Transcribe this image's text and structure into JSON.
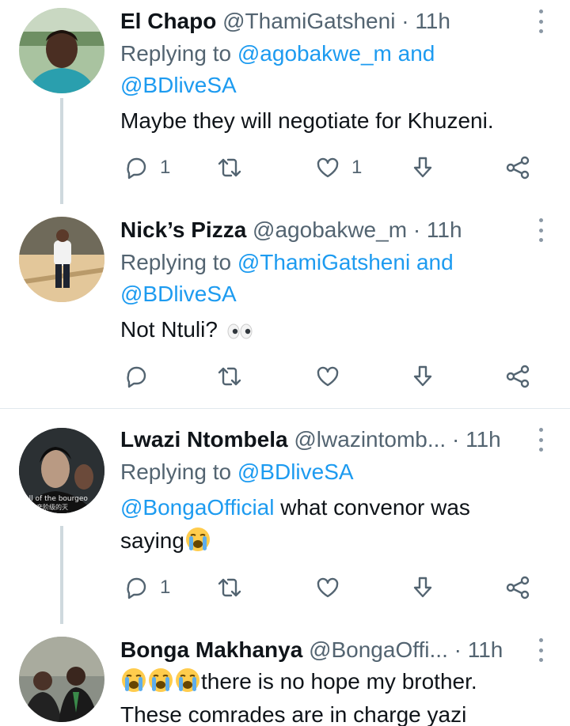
{
  "tweets": [
    {
      "name": "El Chapo",
      "handle": "@ThamiGatsheni",
      "time": "11h",
      "replying_prefix": "Replying to",
      "replying_users_line1": "@agobakwe_m and",
      "replying_users_line2": "@BDliveSA",
      "text": "Maybe they will negotiate for Khuzeni.",
      "reply_count": "1",
      "retweet_count": "",
      "like_count": "1"
    },
    {
      "name": "Nick’s Pizza",
      "handle": "@agobakwe_m",
      "time": "11h",
      "replying_prefix": "Replying to",
      "replying_users_line1": "@ThamiGatsheni and",
      "replying_users_line2": "@BDliveSA",
      "text": "Not Ntuli?",
      "emoji": "eyes",
      "reply_count": "",
      "retweet_count": "",
      "like_count": ""
    },
    {
      "name": "Lwazi Ntombela",
      "handle": "@lwazintomb...",
      "time": "11h",
      "replying_prefix": "Replying to",
      "replying_users_line1": "@BDliveSA",
      "mention": "@BongaOfficial",
      "text_line1": " what convenor was",
      "text_line2": "saying",
      "emoji": "loudly-crying-face",
      "avatar_caption": "fall of the bourgeo",
      "avatar_caption_sub": "资产阶级的灭",
      "reply_count": "1",
      "retweet_count": "",
      "like_count": ""
    },
    {
      "name": "Bonga Makhanya",
      "handle": "@BongaOffi...",
      "time": "11h",
      "text_line1": "there is no hope my brother.",
      "text_line2": "These comrades are in charge yazi",
      "emoji": "loudly-crying-face"
    }
  ],
  "ui": {
    "separator": "·",
    "accent": "#1d9bf0",
    "muted": "#536471",
    "thread_line": "#cfd9de"
  }
}
